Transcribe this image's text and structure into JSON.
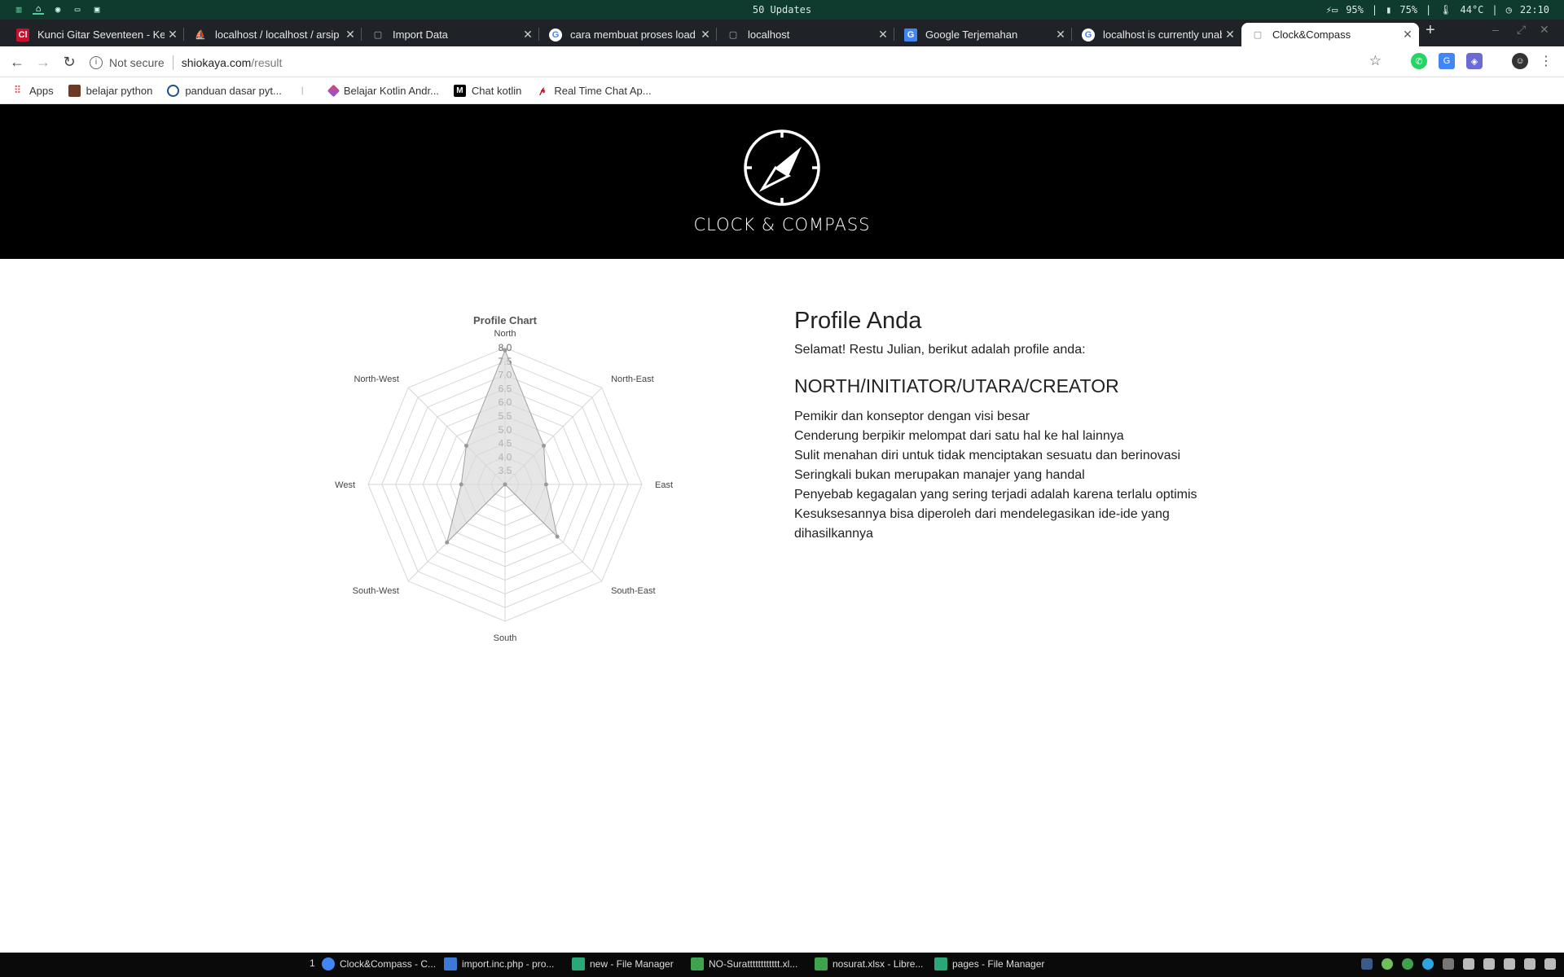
{
  "system_bar": {
    "center_text": "50 Updates",
    "battery": "95%",
    "storage": "75%",
    "temp": "44°C",
    "time": "22:10"
  },
  "tabs": [
    {
      "title": "Kunci Gitar Seventeen - Ke",
      "icon": "cl-icon",
      "icon_text": "Cl",
      "color": "#c8102e"
    },
    {
      "title": "localhost / localhost / arsip",
      "icon": "phpmyadmin-icon",
      "icon_text": "⛵",
      "color": "#f29111"
    },
    {
      "title": "Import Data",
      "icon": "page-icon",
      "icon_text": "▢",
      "color": "#1f2328"
    },
    {
      "title": "cara membuat proses load",
      "icon": "google-icon",
      "icon_text": "G",
      "color": "#ffffff"
    },
    {
      "title": "localhost",
      "icon": "page-icon",
      "icon_text": "▢",
      "color": "#1f2328"
    },
    {
      "title": "Google Terjemahan",
      "icon": "translate-icon",
      "icon_text": "G",
      "color": "#4285f4"
    },
    {
      "title": "localhost is currently unab",
      "icon": "google-icon",
      "icon_text": "G",
      "color": "#ffffff"
    },
    {
      "title": "Clock&Compass",
      "icon": "page-icon",
      "icon_text": "▢",
      "color": "#ffffff"
    }
  ],
  "address_bar": {
    "security_text": "Not secure",
    "host": "shiokaya.com",
    "path": "/result"
  },
  "bookmarks": [
    {
      "label": "Apps",
      "icon": "apps-grid-icon"
    },
    {
      "label": "belajar python",
      "icon": "thumbnail-icon"
    },
    {
      "label": "panduan dasar pyt...",
      "icon": "globe-icon"
    },
    {
      "label": "",
      "icon": "leaf-icon"
    },
    {
      "label": "Belajar Kotlin Andr...",
      "icon": "kotlin-icon"
    },
    {
      "label": "Chat kotlin",
      "icon": "medium-icon"
    },
    {
      "label": "Real Time Chat Ap...",
      "icon": "pinterest-icon"
    }
  ],
  "site": {
    "brand": "CLOCK & COMPASS"
  },
  "chart_data": {
    "type": "radar",
    "title": "Profile Chart",
    "categories": [
      "North",
      "North-East",
      "East",
      "South-East",
      "South",
      "South-West",
      "West",
      "North-West"
    ],
    "series": [
      {
        "name": "",
        "values": [
          7.9,
          5.0,
          4.5,
          5.7,
          3.0,
          6.0,
          4.6,
          5.0
        ]
      }
    ],
    "ticks": [
      "3.5",
      "4.0",
      "4.5",
      "5.0",
      "5.5",
      "6.0",
      "6.5",
      "7.0",
      "7.5",
      "8.0"
    ],
    "rmin": 3.0,
    "rmax": 8.0,
    "fill_color": "#d8d8d8",
    "line_color": "#a0a0a0"
  },
  "profile": {
    "heading": "Profile Anda",
    "greeting": "Selamat! Restu Julian, berikut adalah profile anda:",
    "type_title": "NORTH/INITIATOR/UTARA/CREATOR",
    "traits": [
      "Pemikir dan konseptor dengan visi besar",
      "Cenderung berpikir melompat dari satu hal ke hal lainnya",
      "Sulit menahan diri untuk tidak menciptakan sesuatu dan berinovasi",
      "Seringkali bukan merupakan manajer yang handal",
      "Penyebab kegagalan yang sering terjadi adalah karena terlalu optimis",
      "Kesuksesannya bisa diperoleh dari mendelegasikan ide-ide yang dihasilkannya"
    ]
  },
  "taskbar": {
    "workspace": "1",
    "tasks": [
      {
        "label": "Clock&Compass - C...",
        "icon": "chrome-icon",
        "color": "#4285f4"
      },
      {
        "label": "import.inc.php - pro...",
        "icon": "editor-icon",
        "color": "#3d7ad6"
      },
      {
        "label": "new - File Manager",
        "icon": "folder-icon",
        "color": "#2aa87a"
      },
      {
        "label": "NO-Suratttttttttttt.xl...",
        "icon": "spreadsheet-icon",
        "color": "#3fa34d"
      },
      {
        "label": "nosurat.xlsx - Libre...",
        "icon": "spreadsheet-icon",
        "color": "#3fa34d"
      },
      {
        "label": "pages - File Manager",
        "icon": "folder-icon",
        "color": "#2aa87a"
      }
    ]
  }
}
